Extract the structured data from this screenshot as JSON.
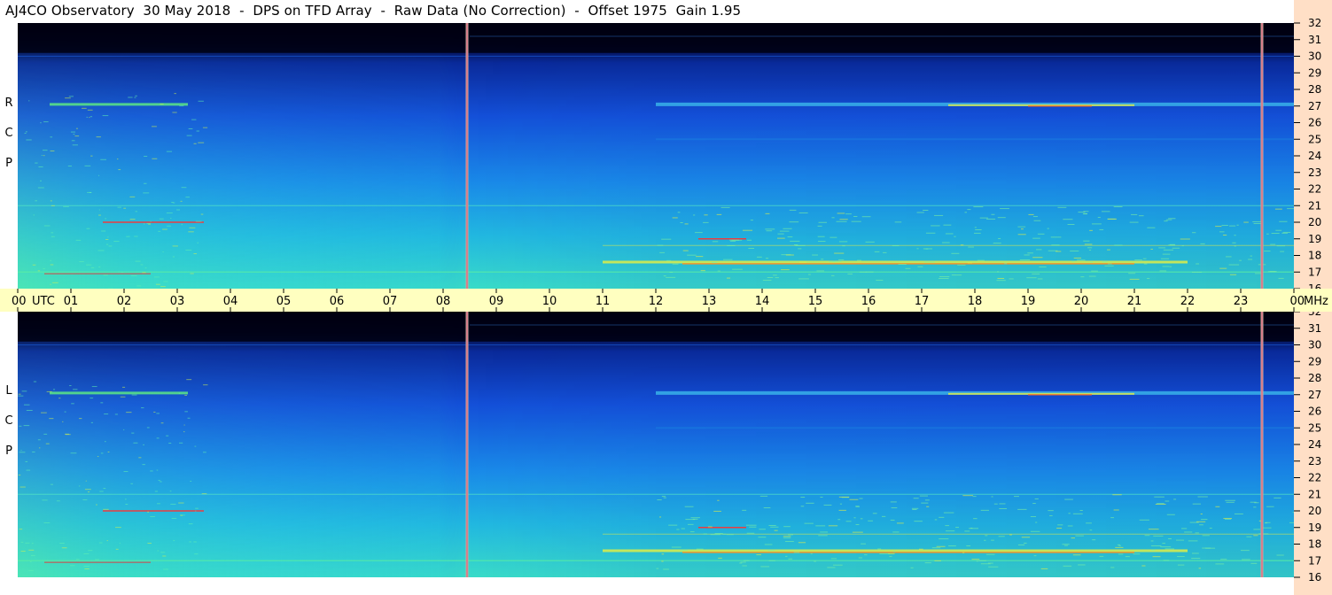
{
  "title": "AJ4CO Observatory  30 May 2018  -  DPS on TFD Array  -  Raw Data (No Correction)  -  Offset 1975  Gain 1.95",
  "panels": [
    {
      "label": "R C P"
    },
    {
      "label": "L C P"
    }
  ],
  "colors": {
    "page_bg": "#ffffff",
    "time_axis_bg": "#ffffc0",
    "freq_axis_bg": "#ffdfc6",
    "spectrogram_scale": [
      "#000010",
      "#08108a",
      "#1a4de0",
      "#1a9ef0",
      "#2ad0d8",
      "#5cf0a0",
      "#e8f040",
      "#ff9020",
      "#ff2020"
    ],
    "marker_line": "#f05078"
  },
  "chart_data": {
    "type": "heatmap",
    "title": "AJ4CO Observatory  30 May 2018  -  DPS on TFD Array  -  Raw Data (No Correction)  -  Offset 1975  Gain 1.95",
    "x_unit": "UTC",
    "y_unit": "MHz",
    "x_tick_labels": [
      "00",
      "01",
      "02",
      "03",
      "04",
      "05",
      "06",
      "07",
      "08",
      "09",
      "10",
      "11",
      "12",
      "13",
      "14",
      "15",
      "16",
      "17",
      "18",
      "19",
      "20",
      "21",
      "22",
      "23",
      "00"
    ],
    "x_range_hours": [
      0,
      24
    ],
    "y_tick_labels": [
      "32",
      "31",
      "30",
      "29",
      "28",
      "27",
      "26",
      "25",
      "24",
      "23",
      "22",
      "21",
      "20",
      "19",
      "18",
      "17",
      "16"
    ],
    "y_range_mhz": [
      16,
      32
    ],
    "panels": [
      "RCP",
      "LCP"
    ],
    "marker_times_utc": [
      8.45,
      23.4
    ],
    "noted_features": [
      {
        "freq_mhz": 27,
        "time_range_utc": [
          11.5,
          24
        ],
        "level": "high"
      },
      {
        "freq_mhz": 17.5,
        "time_range_utc": [
          11,
          22
        ],
        "level": "high"
      },
      {
        "freq_mhz": 19,
        "time_range_utc": [
          12.8,
          13.7
        ],
        "level": "high"
      },
      {
        "freq_mhz": 20,
        "time_range_utc": [
          1.6,
          3.5
        ],
        "level": "high"
      }
    ]
  }
}
